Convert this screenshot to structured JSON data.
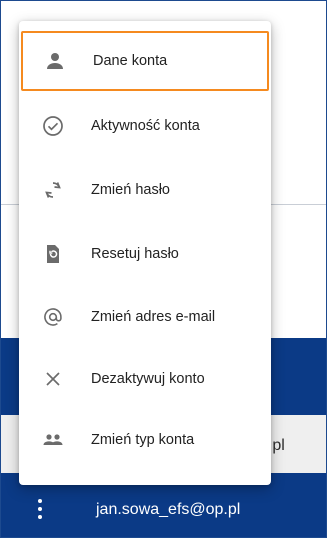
{
  "background": {
    "partial_email": "p.pl",
    "bottom_email": "jan.sowa_efs@op.pl"
  },
  "menu": {
    "items": [
      {
        "label": "Dane konta",
        "icon": "person-icon"
      },
      {
        "label": "Aktywność konta",
        "icon": "check-circle-icon"
      },
      {
        "label": "Zmień hasło",
        "icon": "refresh-icon"
      },
      {
        "label": "Resetuj hasło",
        "icon": "reset-file-icon"
      },
      {
        "label": "Zmień adres e-mail",
        "icon": "at-sign-icon"
      },
      {
        "label": "Dezaktywuj konto",
        "icon": "close-icon"
      },
      {
        "label": "Zmień typ konta",
        "icon": "people-icon"
      }
    ]
  },
  "colors": {
    "brand_blue": "#0b3a86",
    "focus_orange": "#f58a1f",
    "icon_gray": "#6b6b6b"
  }
}
